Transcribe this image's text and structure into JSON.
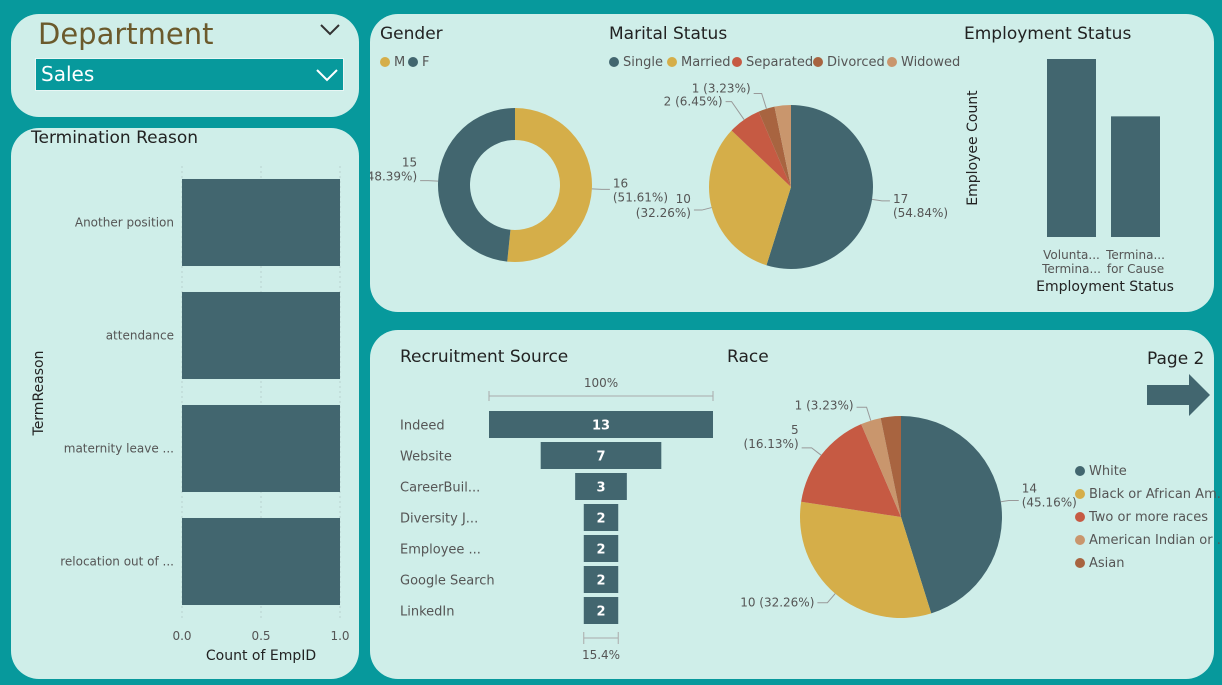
{
  "department": {
    "title": "Department",
    "selected": "Sales"
  },
  "page_nav": {
    "label": "Page 2"
  },
  "colors": {
    "slate": "#42666f",
    "gold": "#d5ae49",
    "red": "#c65a43",
    "brown": "#a86440",
    "tan": "#c9966d",
    "panel": "#cfeee9",
    "teal": "#07999c"
  },
  "chart_data": [
    {
      "id": "termination",
      "type": "bar",
      "orientation": "horizontal",
      "title": "Termination Reason",
      "xlabel": "Count of EmpID",
      "ylabel": "TermReason",
      "categories": [
        "Another position",
        "attendance",
        "maternity leave ...",
        "relocation out of ..."
      ],
      "values": [
        1,
        1,
        1,
        1
      ],
      "xlim": [
        0,
        1
      ],
      "xticks": [
        "0.0",
        "0.5",
        "1.0"
      ],
      "grid": true
    },
    {
      "id": "gender",
      "type": "pie",
      "variant": "donut",
      "title": "Gender",
      "legend_position": "top-left",
      "labels": [
        "M",
        "F"
      ],
      "values": [
        16,
        15
      ],
      "percent_labels": [
        "(51.61%)",
        "(48.39%)"
      ]
    },
    {
      "id": "marital",
      "type": "pie",
      "title": "Marital Status",
      "legend_position": "top-left",
      "labels": [
        "Single",
        "Married",
        "Separated",
        "Divorced",
        "Widowed"
      ],
      "values": [
        17,
        10,
        2,
        1,
        1
      ],
      "data_labels": [
        [
          "17",
          "(54.84%)"
        ],
        [
          "10",
          "(32.26%)"
        ],
        [
          "2 (6.45%)"
        ],
        [
          "1 (3.23%)"
        ],
        []
      ]
    },
    {
      "id": "employment",
      "type": "bar",
      "title": "Employment Status",
      "xlabel": "Employment Status",
      "ylabel": "Employee Count",
      "categories": [
        [
          "Volunta...",
          "Termina..."
        ],
        [
          "Termina...",
          "for Cause"
        ]
      ],
      "values": [
        18,
        12.2
      ]
    },
    {
      "id": "recruitment",
      "type": "bar",
      "variant": "funnel",
      "title": "Recruitment Source",
      "top_label": "100%",
      "bottom_label": "15.4%",
      "categories": [
        "Indeed",
        "Website",
        "CareerBuil...",
        "Diversity J...",
        "Employee ...",
        "Google Search",
        "LinkedIn"
      ],
      "values": [
        13,
        7,
        3,
        2,
        2,
        2,
        2
      ]
    },
    {
      "id": "race",
      "type": "pie",
      "title": "Race",
      "legend_position": "right",
      "labels": [
        "White",
        "Black or African Am...",
        "Two or more races",
        "American Indian or ...",
        "Asian"
      ],
      "values": [
        14,
        10,
        5,
        1,
        1
      ],
      "data_labels": [
        [
          "14",
          "(45.16%)"
        ],
        [
          "10 (32.26%)"
        ],
        [
          "5",
          "(16.13%)"
        ],
        [
          "1 (3.23%)"
        ],
        []
      ]
    }
  ]
}
